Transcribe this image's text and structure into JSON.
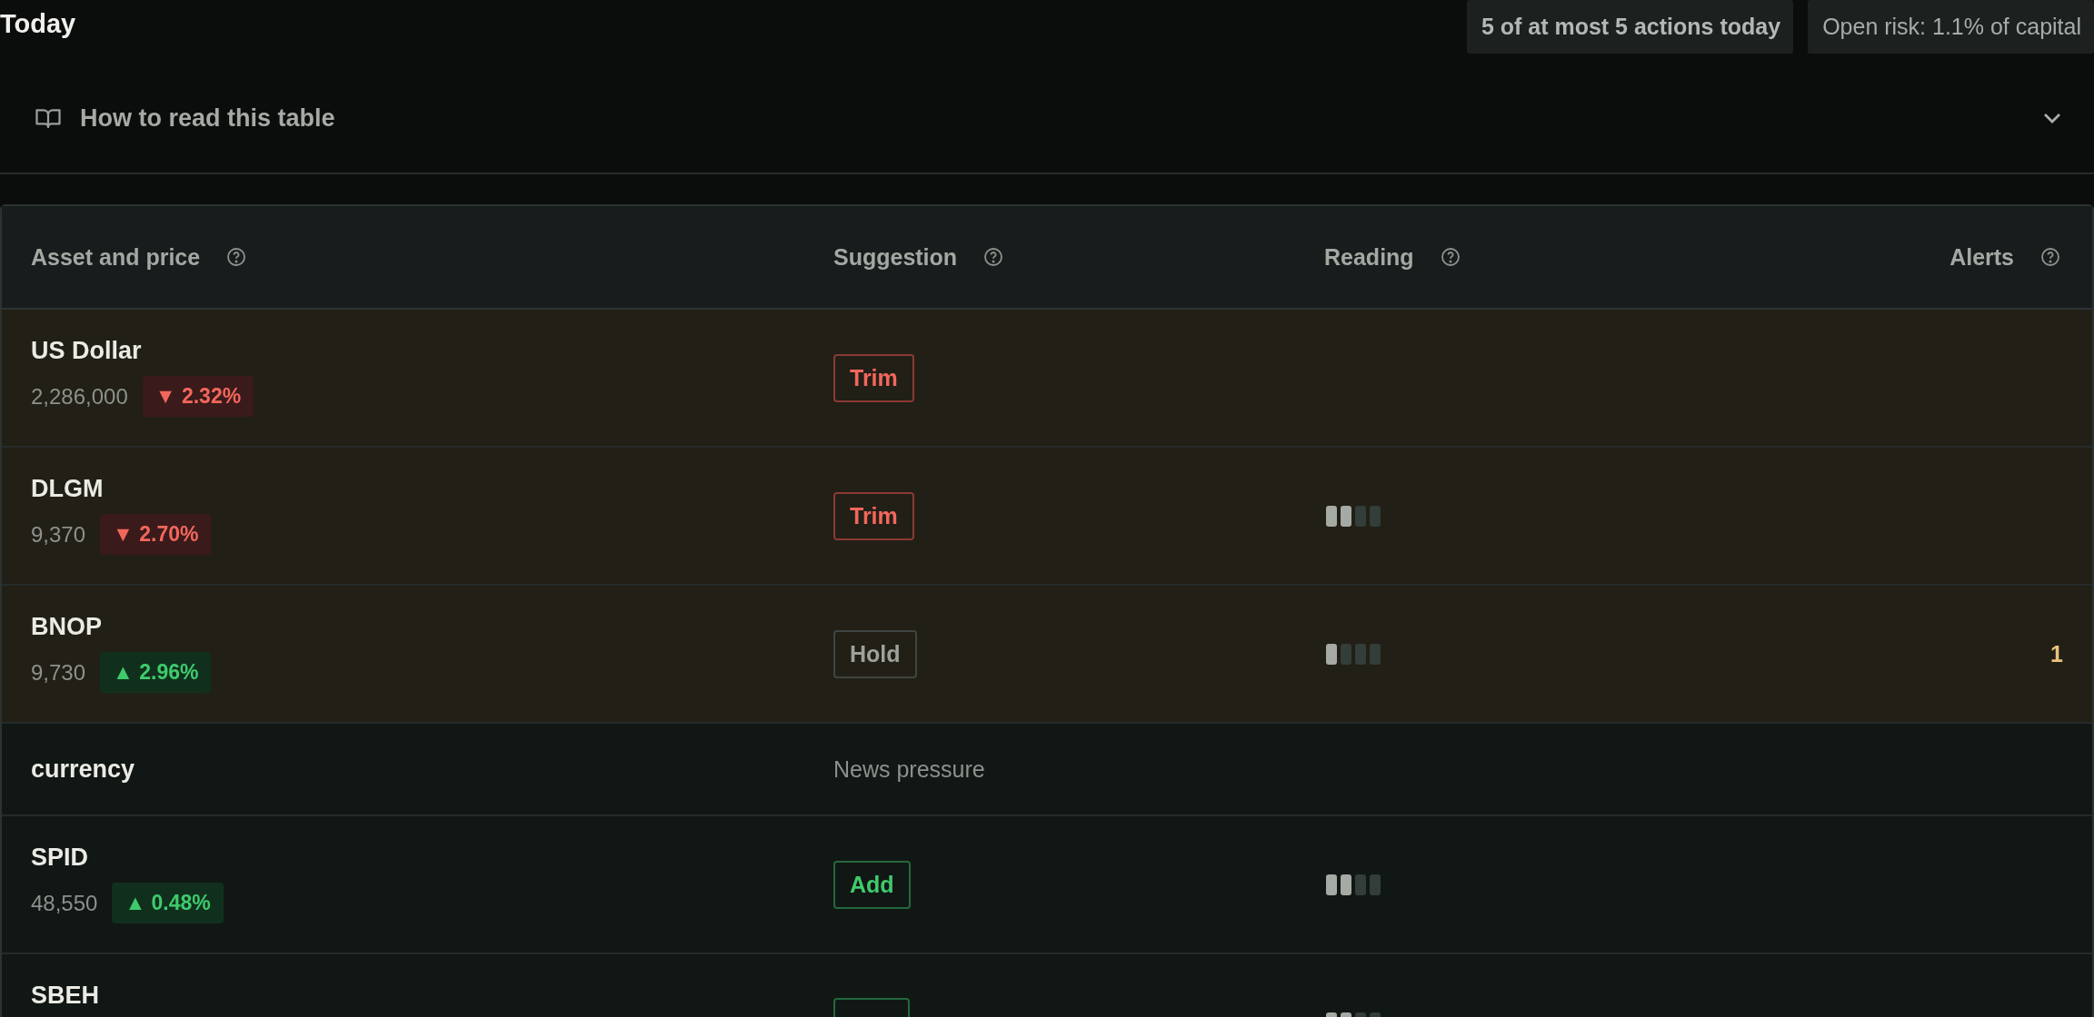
{
  "header": {
    "title": "Today",
    "badges": [
      "5 of at most 5 actions today",
      "Open risk: 1.1% of capital"
    ]
  },
  "help": {
    "label": "How to read this table",
    "expanded": false
  },
  "table": {
    "columns": [
      {
        "label": "Asset and price"
      },
      {
        "label": "Suggestion"
      },
      {
        "label": "Reading"
      },
      {
        "label": "Alerts"
      }
    ],
    "rows": [
      {
        "kind": "asset",
        "highlighted": true,
        "name": "US Dollar",
        "price": "2,286,000",
        "change": {
          "kind": "down",
          "arrow": "▼",
          "value": "2.32%"
        },
        "suggestion": {
          "label": "Trim",
          "kind": "sell"
        }
      },
      {
        "kind": "asset",
        "highlighted": true,
        "name": "DLGM",
        "price": "9,370",
        "change": {
          "kind": "down",
          "arrow": "▼",
          "value": "2.70%"
        },
        "suggestion": {
          "label": "Trim",
          "kind": "sell"
        },
        "reading": {
          "level": 0.5
        }
      },
      {
        "kind": "asset",
        "highlighted": true,
        "name": "BNOP",
        "price": "9,730",
        "change": {
          "kind": "up",
          "arrow": "▲",
          "value": "2.96%"
        },
        "suggestion": {
          "label": "Hold",
          "kind": "hold"
        },
        "reading": {
          "level": 0.25
        },
        "alerts": "1"
      },
      {
        "kind": "group",
        "highlighted": false,
        "name": "currency",
        "note": "News pressure"
      },
      {
        "kind": "asset",
        "highlighted": false,
        "name": "SPID",
        "price": "48,550",
        "change": {
          "kind": "up",
          "arrow": "▲",
          "value": "0.48%"
        },
        "suggestion": {
          "label": "Add",
          "kind": "buy"
        },
        "reading": {
          "level": 0.5
        }
      },
      {
        "kind": "asset",
        "highlighted": false,
        "name": "SBEH",
        "suggestion": {
          "kind": "buy"
        },
        "reading": {
          "level": 0.5
        }
      }
    ]
  }
}
